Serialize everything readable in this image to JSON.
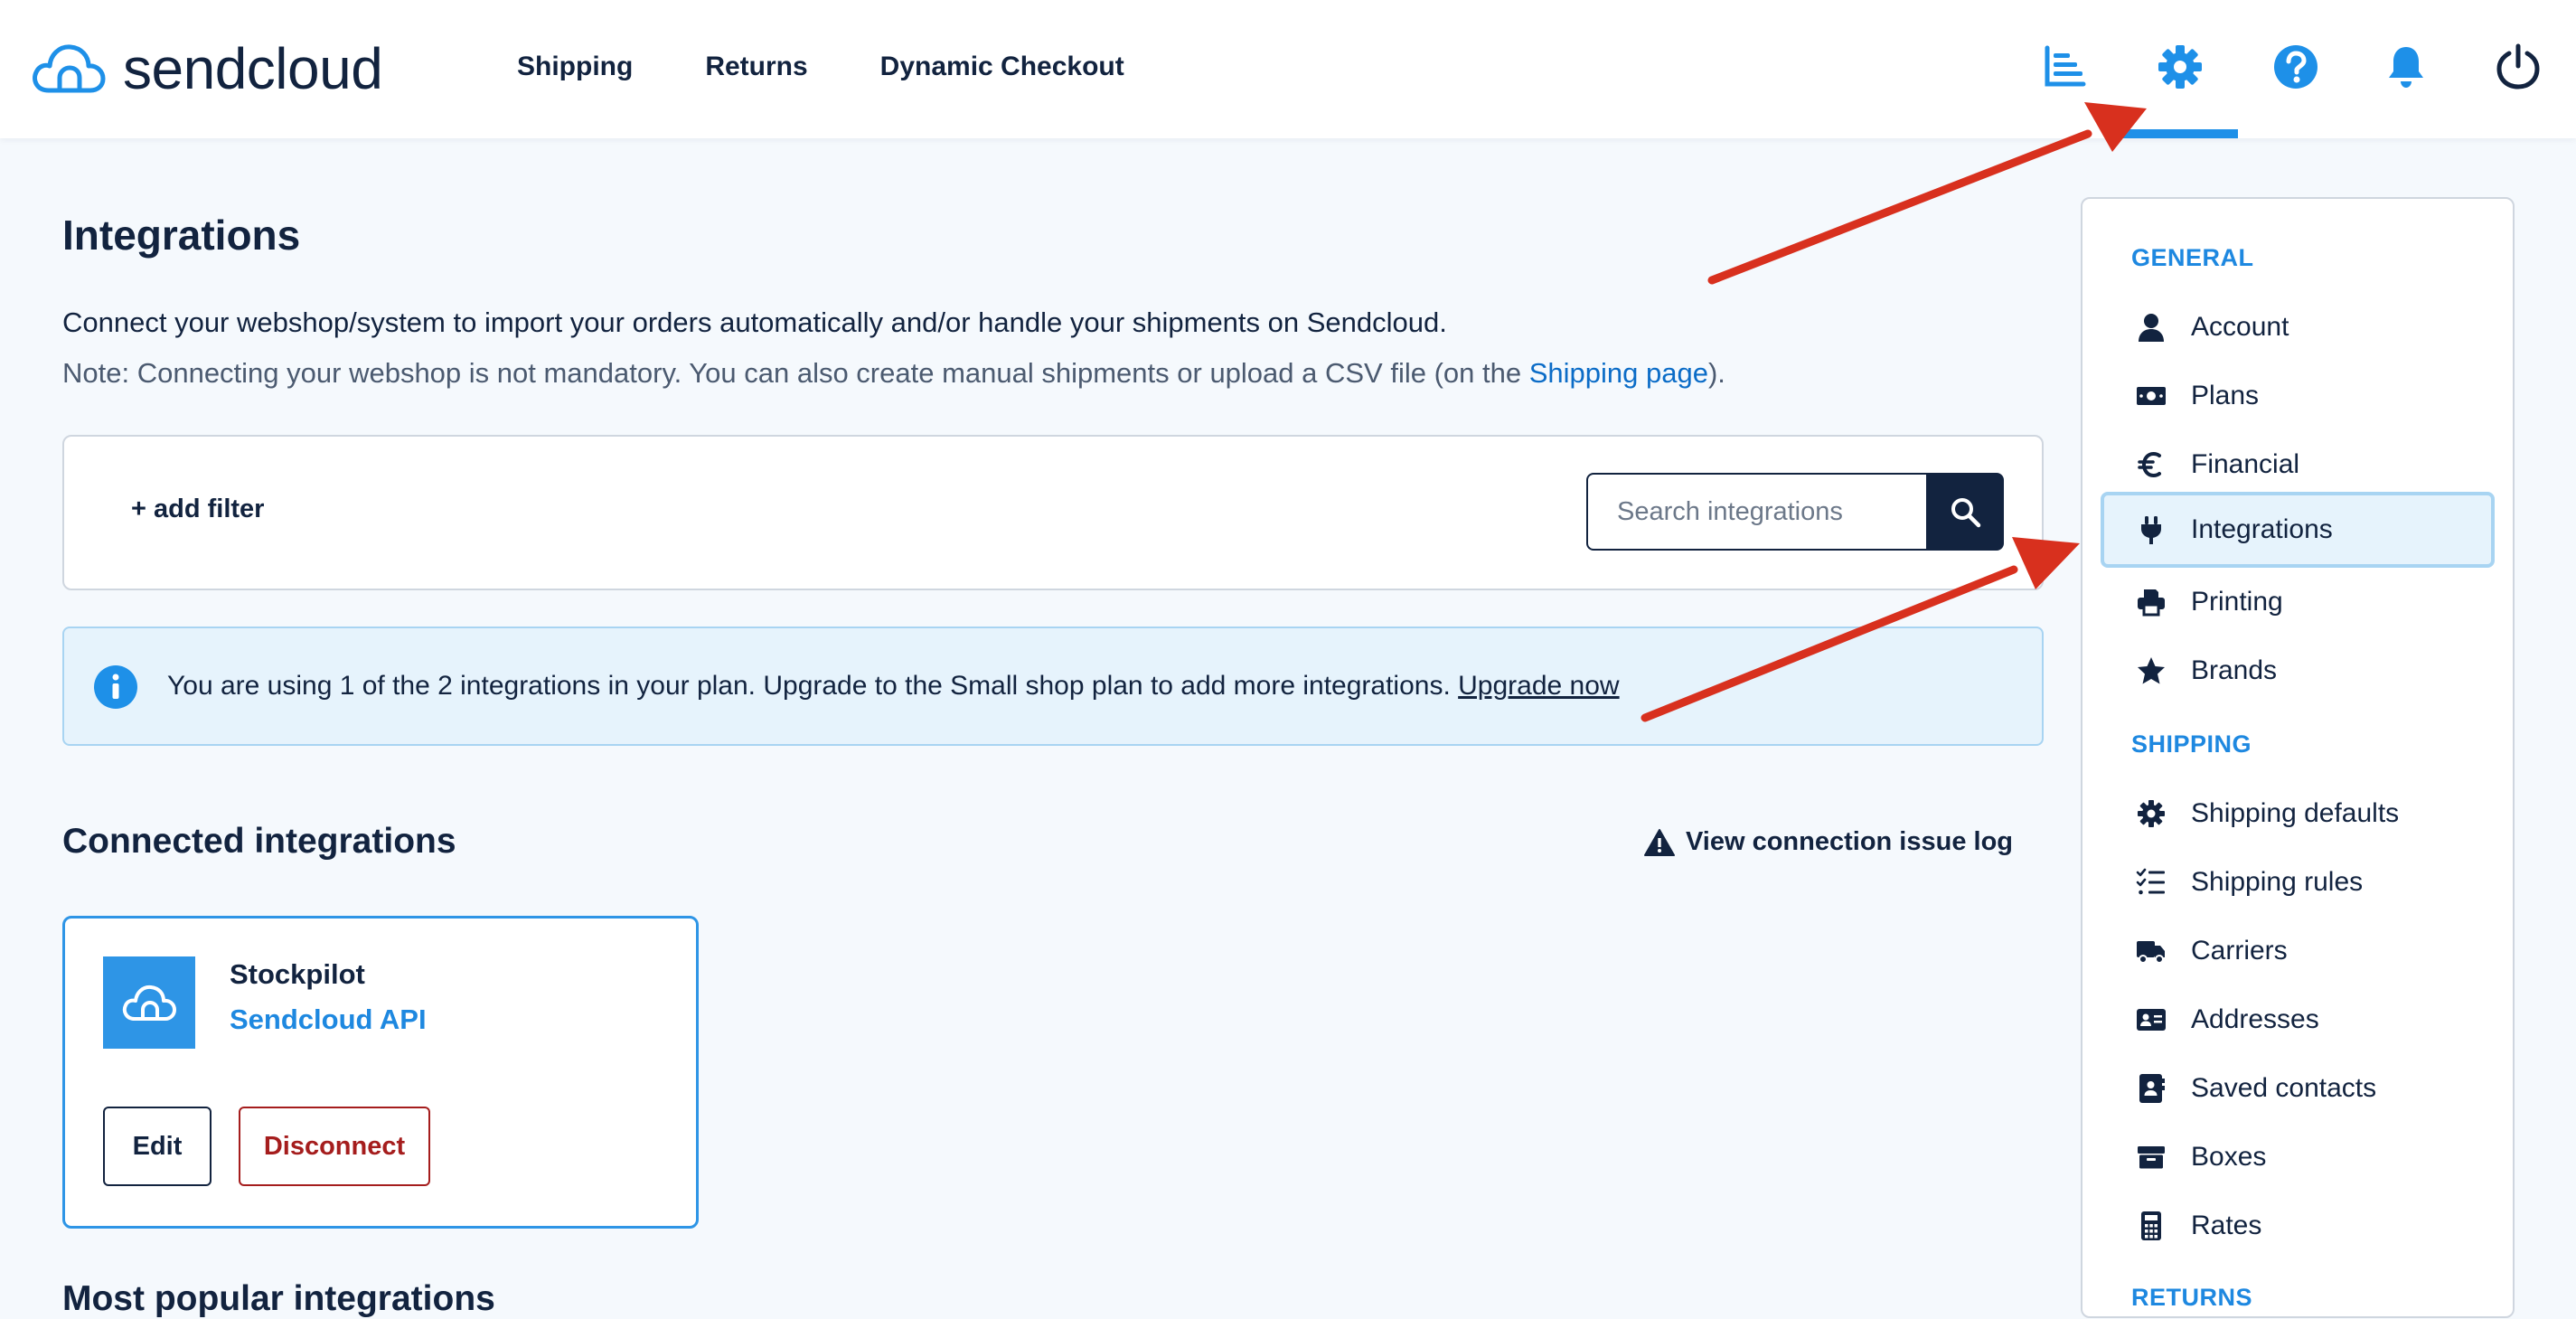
{
  "header": {
    "logo_text": "sendcloud",
    "nav": [
      {
        "label": "Shipping"
      },
      {
        "label": "Returns"
      },
      {
        "label": "Dynamic Checkout"
      }
    ],
    "icons": [
      "analytics-icon",
      "gear-icon",
      "help-icon",
      "bell-icon",
      "power-icon"
    ],
    "active_icon": "gear-icon"
  },
  "page": {
    "title": "Integrations",
    "intro": "Connect your webshop/system to import your orders automatically and/or handle your shipments on Sendcloud.",
    "note_prefix": "Note: Connecting your webshop is not mandatory. You can also create manual shipments or upload a CSV file (on the ",
    "note_link": "Shipping page",
    "note_suffix": ")."
  },
  "filter": {
    "add_filter_label": "+ add filter",
    "search_placeholder": "Search integrations"
  },
  "banner": {
    "text": "You are using 1 of the 2 integrations in your plan. Upgrade to the Small shop plan to add more integrations. ",
    "link": "Upgrade now"
  },
  "connected": {
    "title": "Connected integrations",
    "issue_log_label": "View connection issue log",
    "card": {
      "name": "Stockpilot",
      "type": "Sendcloud API",
      "edit_label": "Edit",
      "disconnect_label": "Disconnect"
    }
  },
  "next_section_title": "Most popular integrations",
  "sidebar": {
    "general_heading": "GENERAL",
    "shipping_heading": "SHIPPING",
    "returns_heading": "RETURNS",
    "general_items": [
      {
        "label": "Account",
        "icon": "user-icon"
      },
      {
        "label": "Plans",
        "icon": "money-icon"
      },
      {
        "label": "Financial",
        "icon": "euro-icon"
      },
      {
        "label": "Integrations",
        "icon": "plug-icon"
      },
      {
        "label": "Printing",
        "icon": "printer-icon"
      },
      {
        "label": "Brands",
        "icon": "star-icon"
      }
    ],
    "shipping_items": [
      {
        "label": "Shipping defaults",
        "icon": "gear-icon"
      },
      {
        "label": "Shipping rules",
        "icon": "checklist-icon"
      },
      {
        "label": "Carriers",
        "icon": "truck-icon"
      },
      {
        "label": "Addresses",
        "icon": "address-card-icon"
      },
      {
        "label": "Saved contacts",
        "icon": "contact-book-icon"
      },
      {
        "label": "Boxes",
        "icon": "box-icon"
      },
      {
        "label": "Rates",
        "icon": "calculator-icon"
      }
    ],
    "active_item": "Integrations"
  },
  "colors": {
    "navy": "#12233f",
    "accent_blue": "#1e90e8",
    "danger": "#a51d1d",
    "annotation_red": "#d8301e"
  }
}
